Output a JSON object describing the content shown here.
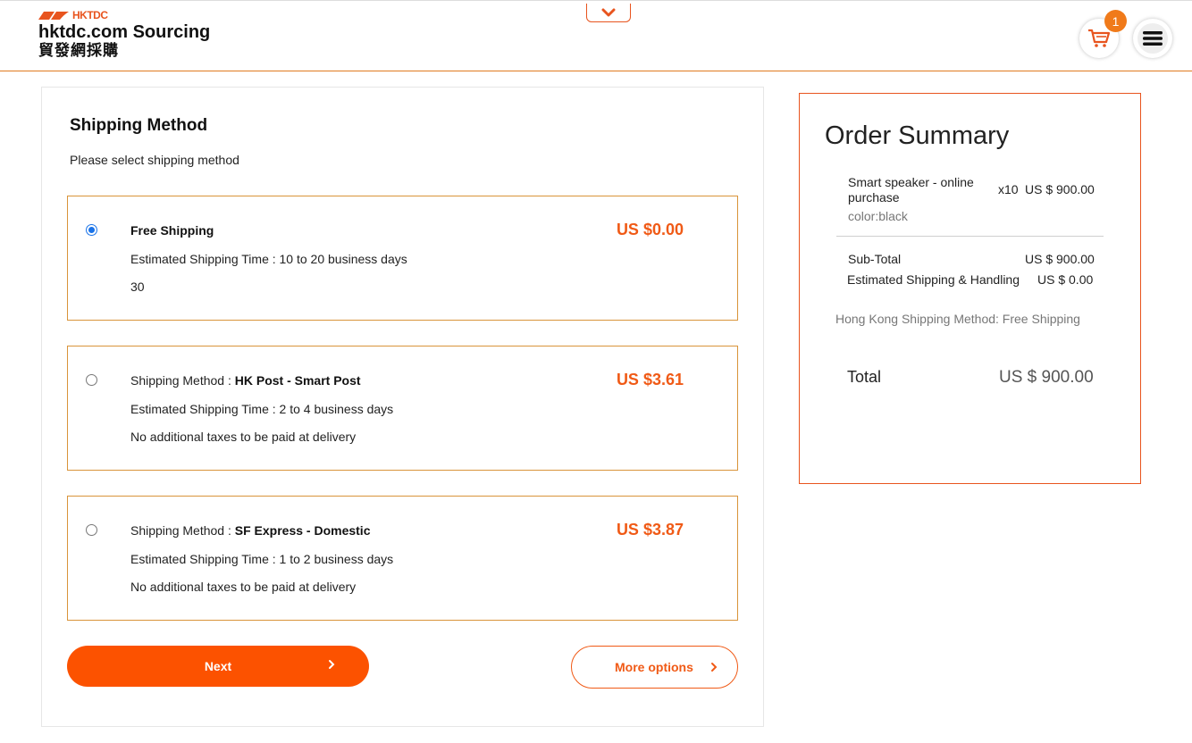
{
  "header": {
    "logo_mark": "HKTDC",
    "logo_title": "hktdc.com Sourcing",
    "logo_subtitle": "貿發網採購",
    "cart_count": "1",
    "brand_color": "#fc5200"
  },
  "shipping": {
    "title": "Shipping Method",
    "subtitle": "Please select shipping method",
    "options": [
      {
        "selected": true,
        "line1_prefix": "",
        "line1_name": "Free Shipping",
        "line2": "Estimated Shipping Time : 10 to 20 business days",
        "line3": "30",
        "price": "US $0.00"
      },
      {
        "selected": false,
        "line1_prefix": "Shipping Method : ",
        "line1_name": "HK Post - Smart Post",
        "line2": "Estimated Shipping Time : 2 to 4 business days",
        "line3": "No additional taxes to be paid at delivery",
        "price": "US $3.61"
      },
      {
        "selected": false,
        "line1_prefix": "Shipping Method : ",
        "line1_name": "SF Express - Domestic",
        "line2": "Estimated Shipping Time : 1 to 2 business days",
        "line3": "No additional taxes to be paid at delivery",
        "price": "US $3.87"
      }
    ],
    "next_label": "Next",
    "more_options_label": "More options"
  },
  "summary": {
    "title": "Order Summary",
    "item": {
      "name": "Smart speaker - online purchase",
      "qty": "x10",
      "price": "US $ 900.00",
      "color": "color:black"
    },
    "subtotal_label": "Sub-Total",
    "subtotal_value": "US $ 900.00",
    "shipping_label": "Estimated Shipping & Handling",
    "shipping_value": "US $ 0.00",
    "shipping_method": "Hong Kong Shipping Method: Free Shipping",
    "total_label": "Total",
    "total_value": "US $ 900.00"
  }
}
